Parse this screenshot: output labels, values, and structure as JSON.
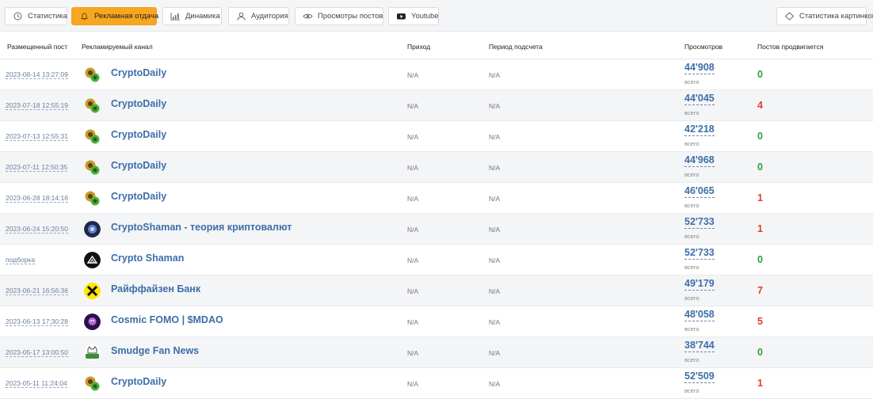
{
  "toolbar": {
    "tabs": [
      {
        "label": "Статистика",
        "icon": "clock-icon"
      },
      {
        "label": "Рекламная отдача",
        "icon": "bell-icon",
        "active": true
      },
      {
        "label": "Динамика",
        "icon": "chart-icon"
      },
      {
        "label": "Аудитория",
        "icon": "audience-icon"
      },
      {
        "label": "Просмотры постов",
        "icon": "eye-icon"
      },
      {
        "label": "Youtube",
        "icon": "youtube-icon"
      }
    ],
    "right_button": {
      "label": "Статистика картинкой",
      "icon": "image-icon"
    }
  },
  "table": {
    "headers": {
      "post": "Размещенный пост",
      "channel": "Рекламируемый канал",
      "income": "Приход",
      "period": "Период подсчета",
      "views": "Просмотров",
      "promoted": "Постов продвигается"
    },
    "views_sub": "всего",
    "colors": {
      "green": "#2e9e3a",
      "red": "#e23b2e",
      "link": "#3d6ea8"
    },
    "rows": [
      {
        "post": "2023-08-14 13:27:09",
        "channel": "CryptoDaily",
        "avatar": "cryptodaily",
        "income": "N/A",
        "period": "N/A",
        "views": "44'908",
        "count": "0",
        "count_color": "green"
      },
      {
        "post": "2023-07-18 12:55:19",
        "channel": "CryptoDaily",
        "avatar": "cryptodaily",
        "income": "N/A",
        "period": "N/A",
        "views": "44'045",
        "count": "4",
        "count_color": "red"
      },
      {
        "post": "2023-07-13 12:55:31",
        "channel": "CryptoDaily",
        "avatar": "cryptodaily",
        "income": "N/A",
        "period": "N/A",
        "views": "42'218",
        "count": "0",
        "count_color": "green"
      },
      {
        "post": "2023-07-11 12:50:35",
        "channel": "CryptoDaily",
        "avatar": "cryptodaily",
        "income": "N/A",
        "period": "N/A",
        "views": "44'968",
        "count": "0",
        "count_color": "green"
      },
      {
        "post": "2023-06-28 18:14:16",
        "channel": "CryptoDaily",
        "avatar": "cryptodaily",
        "income": "N/A",
        "period": "N/A",
        "views": "46'065",
        "count": "1",
        "count_color": "red"
      },
      {
        "post": "2023-06-24 15:20:50",
        "channel": "CryptoShaman - теория криптовалют",
        "avatar": "cryptoshaman-blue",
        "income": "N/A",
        "period": "N/A",
        "views": "52'733",
        "count": "1",
        "count_color": "red"
      },
      {
        "post": "подборка",
        "channel": "Crypto Shaman",
        "avatar": "cryptoshaman-black",
        "income": "N/A",
        "period": "N/A",
        "views": "52'733",
        "count": "0",
        "count_color": "green"
      },
      {
        "post": "2023-06-21 16:56:36",
        "channel": "Райффайзен Банк",
        "avatar": "raiffeisen",
        "income": "N/A",
        "period": "N/A",
        "views": "49'179",
        "count": "7",
        "count_color": "red"
      },
      {
        "post": "2023-06-13 17:30:28",
        "channel": "Cosmic FOMO | $MDAO",
        "avatar": "cosmic",
        "income": "N/A",
        "period": "N/A",
        "views": "48'058",
        "count": "5",
        "count_color": "red"
      },
      {
        "post": "2023-05-17 13:00:50",
        "channel": "Smudge Fan News",
        "avatar": "smudge",
        "income": "N/A",
        "period": "N/A",
        "views": "38'744",
        "count": "0",
        "count_color": "green"
      },
      {
        "post": "2023-05-11 11:24:04",
        "channel": "CryptoDaily",
        "avatar": "cryptodaily",
        "income": "N/A",
        "period": "N/A",
        "views": "52'509",
        "count": "1",
        "count_color": "red"
      }
    ]
  }
}
